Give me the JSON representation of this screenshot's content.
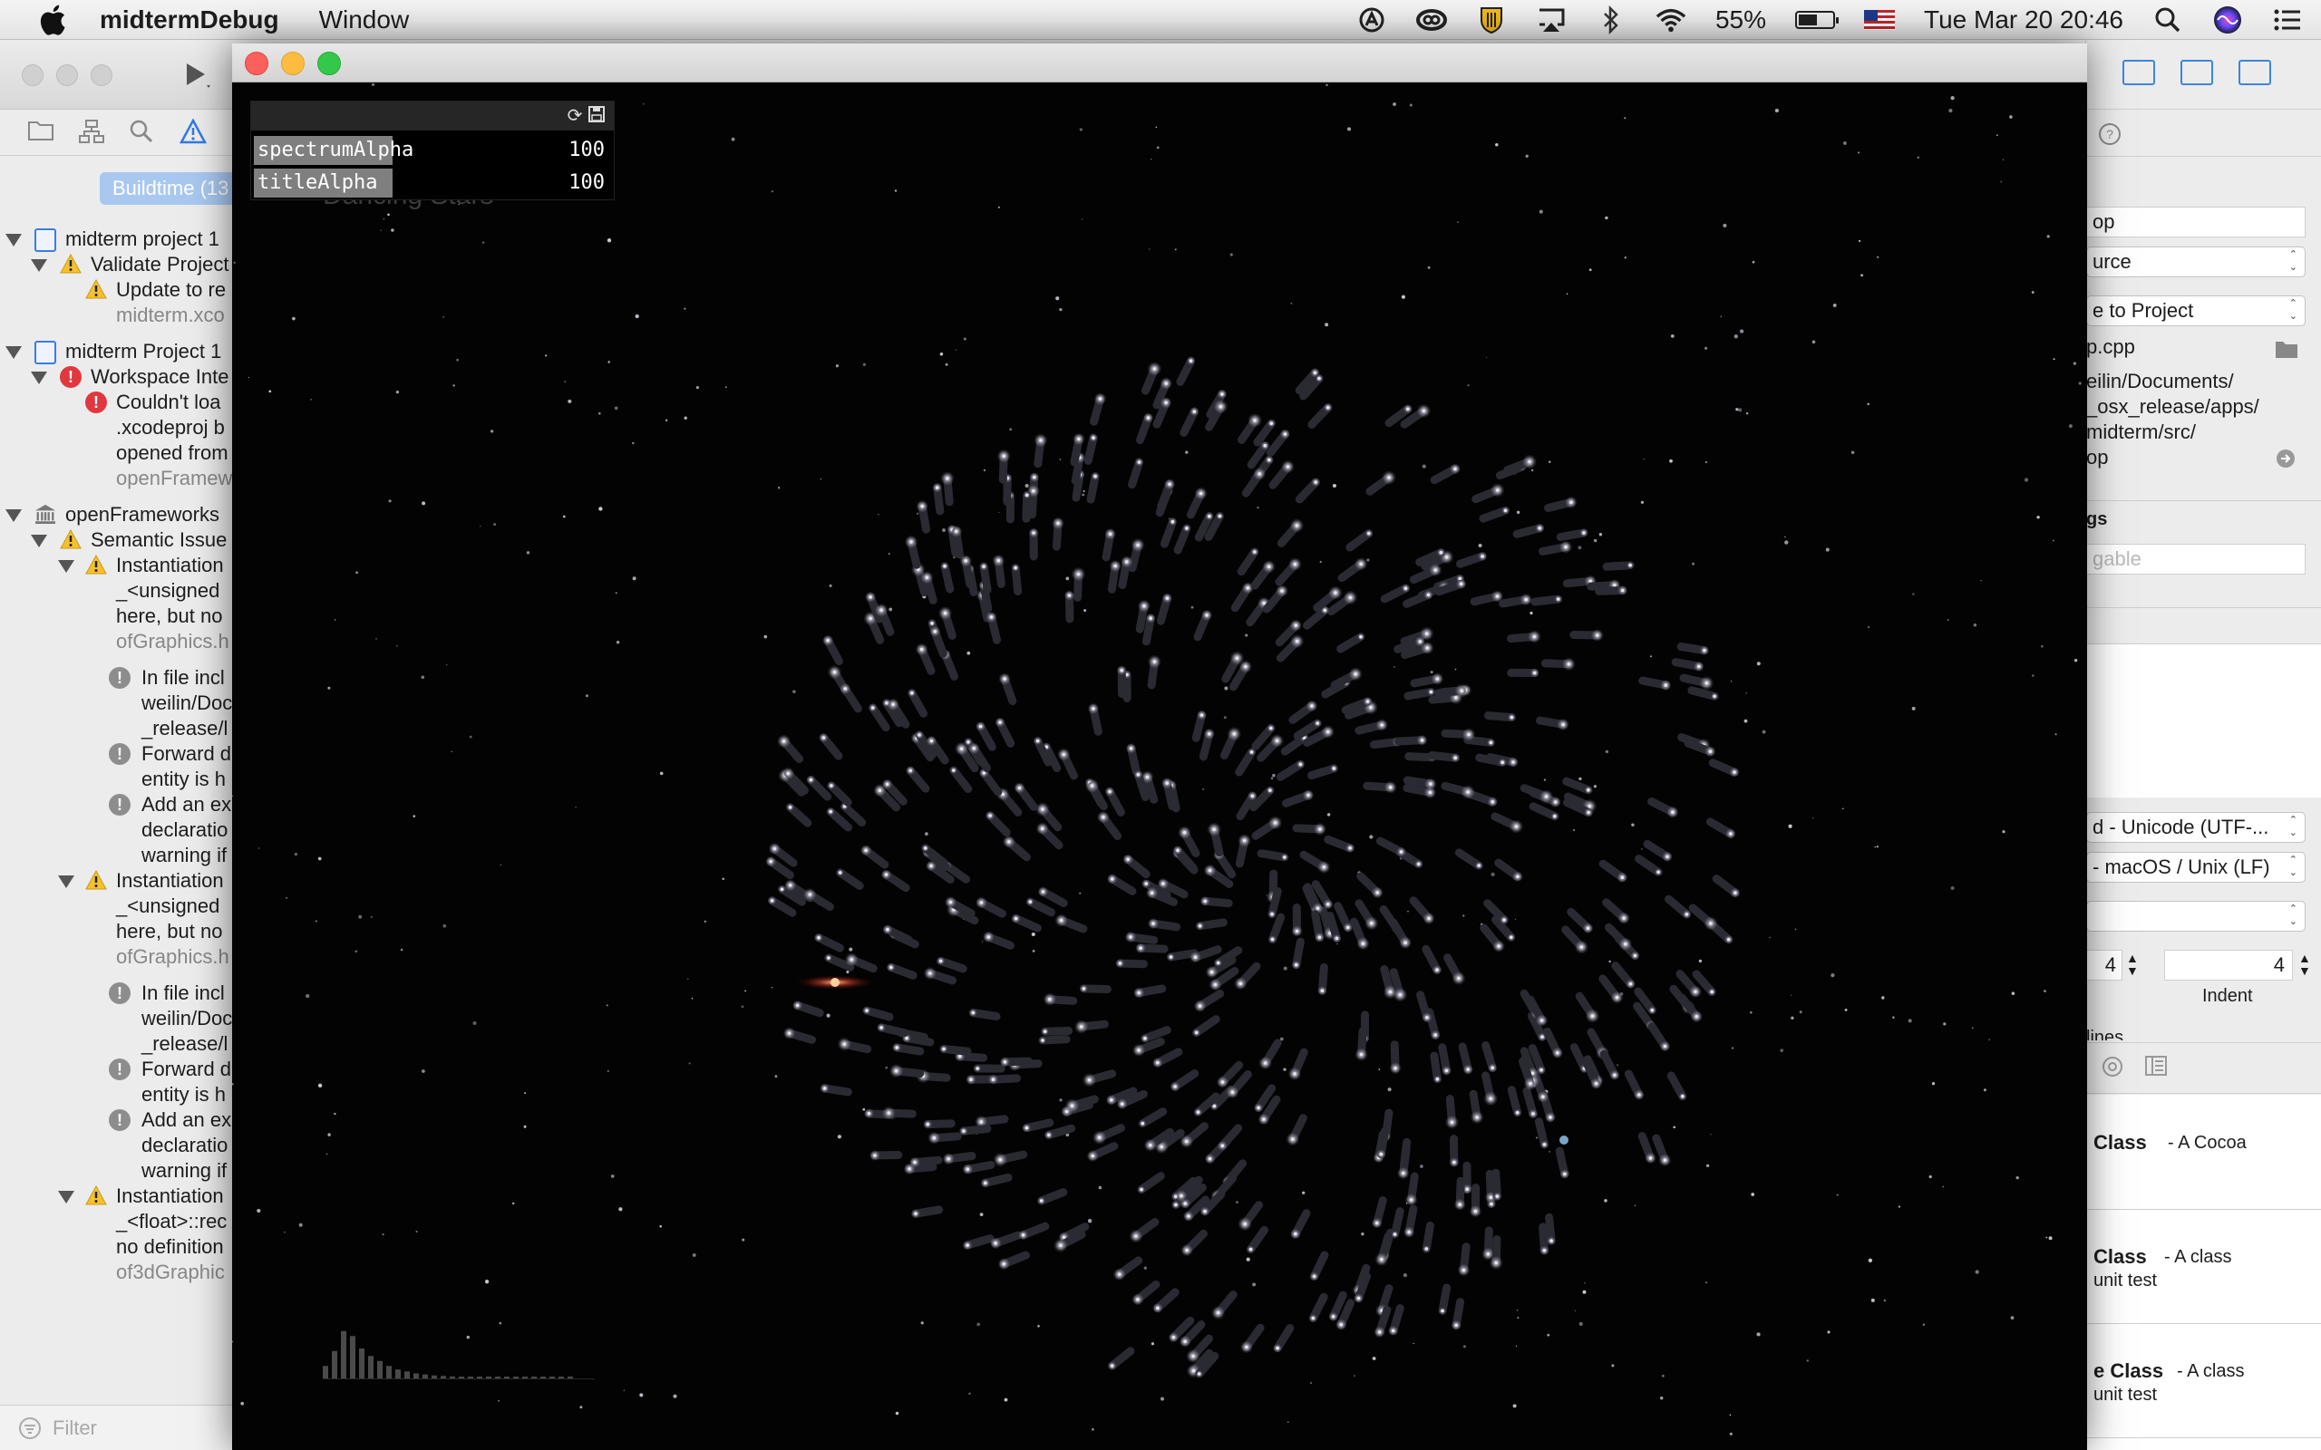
{
  "menubar": {
    "app_name": "midtermDebug",
    "menu_items": [
      "Window"
    ],
    "battery_percent": "55%",
    "battery_level": 0.55,
    "datetime": "Tue Mar 20  20:46"
  },
  "xcode": {
    "filter_tab": "Buildtime (13",
    "filter_placeholder": "Filter",
    "issues": [
      {
        "text": "midterm project 1",
        "level": 0,
        "icon": "project-icon",
        "disclosure": true
      },
      {
        "text": "Validate Project",
        "level": 1,
        "icon": "warning-icon",
        "disclosure": true
      },
      {
        "text": "Update to re",
        "level": 2,
        "icon": "warning-icon"
      },
      {
        "text": "midterm.xco",
        "level": 2,
        "gray": true
      },
      {
        "text": "midterm Project 1",
        "level": 0,
        "icon": "project-icon",
        "disclosure": true
      },
      {
        "text": "Workspace Inte",
        "level": 1,
        "icon": "error-icon",
        "disclosure": true
      },
      {
        "text": "Couldn't loa",
        "level": 2,
        "icon": "error-icon"
      },
      {
        "text": ".xcodeproj b",
        "level": 2
      },
      {
        "text": "opened from",
        "level": 2
      },
      {
        "text": "openFramew",
        "level": 2,
        "gray": true
      },
      {
        "text": "openFrameworks",
        "level": 0,
        "icon": "library-icon",
        "disclosure": true
      },
      {
        "text": "Semantic Issue",
        "level": 1,
        "icon": "warning-icon",
        "disclosure": true
      },
      {
        "text": "Instantiation",
        "level": 2,
        "icon": "warning-icon",
        "disclosure": true
      },
      {
        "text": "_<unsigned",
        "level": 2
      },
      {
        "text": "here, but no",
        "level": 2
      },
      {
        "text": "ofGraphics.h",
        "level": 2,
        "gray": true
      },
      {
        "text": "In file incl",
        "level": 3,
        "icon": "note-icon"
      },
      {
        "text": "weilin/Doc",
        "level": 3
      },
      {
        "text": "_release/l",
        "level": 3
      },
      {
        "text": "Forward d",
        "level": 3,
        "icon": "note-icon"
      },
      {
        "text": "entity is h",
        "level": 3
      },
      {
        "text": "Add an ex",
        "level": 3,
        "icon": "note-icon"
      },
      {
        "text": "declaratio",
        "level": 3
      },
      {
        "text": "warning if",
        "level": 3
      },
      {
        "text": "Instantiation",
        "level": 2,
        "icon": "warning-icon",
        "disclosure": true
      },
      {
        "text": "_<unsigned",
        "level": 2
      },
      {
        "text": "here, but no",
        "level": 2
      },
      {
        "text": "ofGraphics.h",
        "level": 2,
        "gray": true
      },
      {
        "text": "In file incl",
        "level": 3,
        "icon": "note-icon"
      },
      {
        "text": "weilin/Doc",
        "level": 3
      },
      {
        "text": "_release/l",
        "level": 3
      },
      {
        "text": "Forward d",
        "level": 3,
        "icon": "note-icon"
      },
      {
        "text": "entity is h",
        "level": 3
      },
      {
        "text": "Add an ex",
        "level": 3,
        "icon": "note-icon"
      },
      {
        "text": "declaratio",
        "level": 3
      },
      {
        "text": "warning if",
        "level": 3
      },
      {
        "text": "Instantiation",
        "level": 2,
        "icon": "warning-icon",
        "disclosure": true
      },
      {
        "text": "_<float>::rec",
        "level": 2
      },
      {
        "text": "no definition",
        "level": 2
      },
      {
        "text": "of3dGraphic",
        "level": 2,
        "gray": true
      }
    ],
    "inspector": {
      "name_field": "op",
      "type_popup": "urce",
      "location_popup": "e to Project",
      "file_name": "p.cpp",
      "full_path": [
        "eilin/Documents/",
        "_osx_release/apps/",
        "midterm/src/",
        "op"
      ],
      "tags_label": "gs",
      "tags_placeholder": "gable",
      "encoding_popup": "d - Unicode (UTF-...",
      "line_endings_popup": "- macOS / Unix (LF)",
      "tab_width": "4",
      "indent_width": "4",
      "indent_label": "Indent",
      "wrap_label": "lines",
      "templates": [
        {
          "name": "Class",
          "desc": " - A Cocoa",
          "desc2": ""
        },
        {
          "name": "Class",
          "desc": " - A class",
          "desc2": "unit test"
        },
        {
          "name": "e Class",
          "desc": " - A class",
          "desc2": "unit test"
        }
      ]
    }
  },
  "of_window": {
    "gui": {
      "params": [
        {
          "label": "spectrumAlpha",
          "value": "100",
          "fill_fraction": 0.39
        },
        {
          "label": "titleAlpha",
          "value": "100",
          "fill_fraction": 0.39
        }
      ]
    },
    "title_text": "Dancing Stars",
    "spectrum_levels": [
      0.25,
      0.55,
      0.95,
      0.85,
      0.6,
      0.45,
      0.35,
      0.25,
      0.18,
      0.14,
      0.1,
      0.08,
      0.06,
      0.05,
      0.04,
      0.03,
      0.03,
      0.02,
      0.02,
      0.02,
      0.01,
      0.01,
      0.01,
      0.01,
      0.01,
      0.01,
      0.01,
      0.01
    ]
  }
}
